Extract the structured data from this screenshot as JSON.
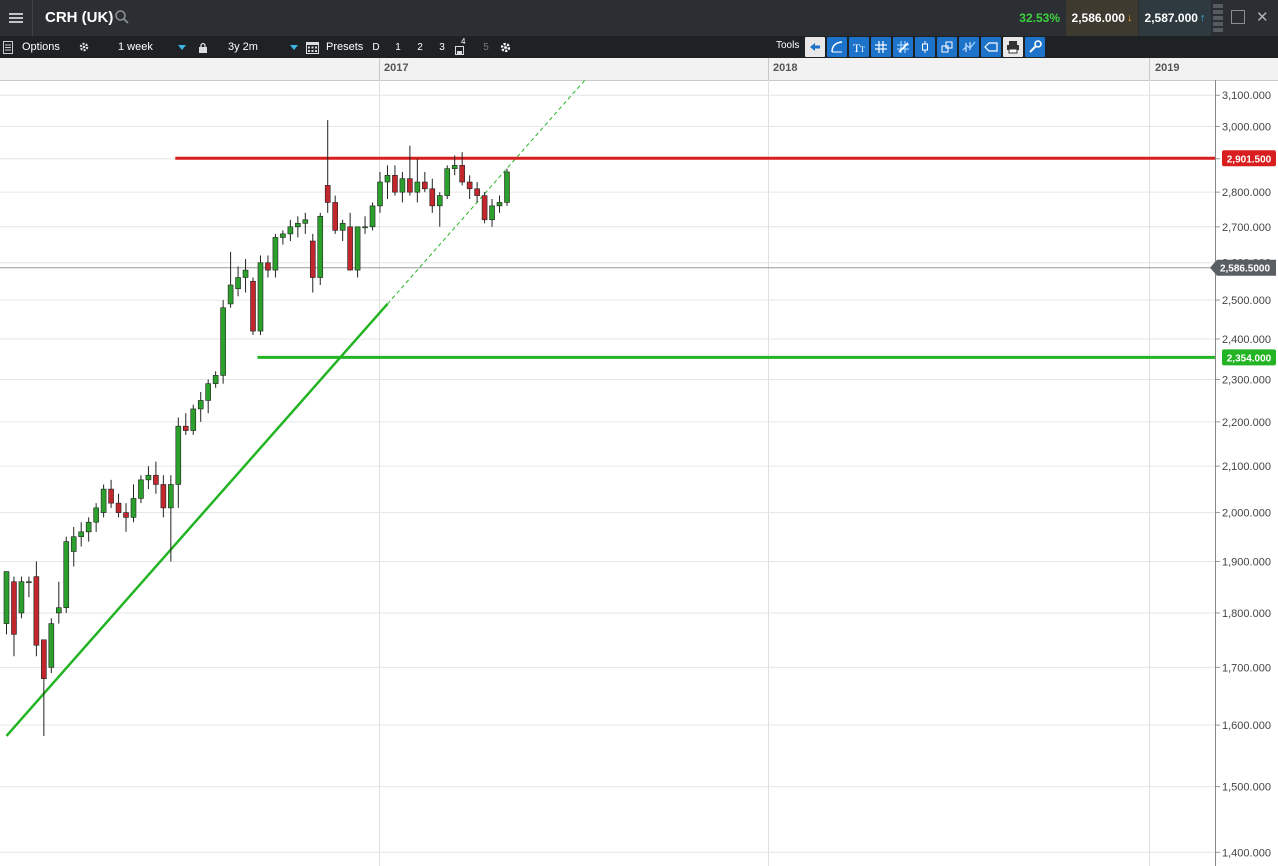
{
  "header": {
    "title": "CRH (UK)",
    "change_pct": "32.53%",
    "sell_price": "2,586.000",
    "buy_price": "2,587.000"
  },
  "toolbar": {
    "options_label": "Options",
    "interval": "1 week",
    "range": "3y 2m",
    "presets_label": "Presets",
    "preset_buttons": [
      "D",
      "1",
      "2",
      "3",
      "4",
      "5"
    ],
    "tools_label": "Tools"
  },
  "colors": {
    "up_candle": "#2ca02c",
    "down_candle": "#c1272d",
    "resistance": "#d81e1e",
    "support": "#22b422",
    "trendline": "#22b422",
    "tool_blue": "#1d73c9"
  },
  "chart_data": {
    "type": "candlestick",
    "x_axis_labels": [
      "2017",
      "2018",
      "2019"
    ],
    "y_ticks": [
      "3,100.000",
      "3,000.000",
      "2,900.000",
      "2,800.000",
      "2,700.000",
      "2,600.000",
      "2,500.000",
      "2,400.000",
      "2,300.000",
      "2,200.000",
      "2,100.000",
      "2,000.000",
      "1,900.000",
      "1,800.000",
      "1,700.000",
      "1,600.000",
      "1,500.000",
      "1,400.000"
    ],
    "y_tick_values": [
      3100,
      3000,
      2900,
      2800,
      2700,
      2600,
      2500,
      2400,
      2300,
      2200,
      2100,
      2000,
      1900,
      1800,
      1700,
      1600,
      1500,
      1400
    ],
    "ylim": [
      1380,
      3150
    ],
    "scale": "log",
    "first_week": "2016-08-01",
    "current_price_label": "2,586.5000",
    "current_price": 2586.5,
    "resistance": {
      "value": 2901.5,
      "label": "2,901.500",
      "start_week": 23
    },
    "support": {
      "value": 2354,
      "label": "2,354.000",
      "start_week": 34
    },
    "trendline": {
      "start": [
        0,
        1582
      ],
      "end": [
        51,
        2490
      ],
      "extend_to_week": 83
    },
    "candles": [
      {
        "o": 1780,
        "h": 1880,
        "l": 1760,
        "c": 1880
      },
      {
        "o": 1860,
        "h": 1870,
        "l": 1720,
        "c": 1760
      },
      {
        "o": 1800,
        "h": 1870,
        "l": 1790,
        "c": 1860
      },
      {
        "o": 1860,
        "h": 1870,
        "l": 1830,
        "c": 1860
      },
      {
        "o": 1870,
        "h": 1900,
        "l": 1720,
        "c": 1740
      },
      {
        "o": 1750,
        "h": 1750,
        "l": 1582,
        "c": 1680
      },
      {
        "o": 1700,
        "h": 1790,
        "l": 1690,
        "c": 1780
      },
      {
        "o": 1800,
        "h": 1860,
        "l": 1780,
        "c": 1810
      },
      {
        "o": 1810,
        "h": 1950,
        "l": 1800,
        "c": 1940
      },
      {
        "o": 1920,
        "h": 1970,
        "l": 1890,
        "c": 1950
      },
      {
        "o": 1950,
        "h": 1980,
        "l": 1930,
        "c": 1960
      },
      {
        "o": 1960,
        "h": 1990,
        "l": 1940,
        "c": 1980
      },
      {
        "o": 1980,
        "h": 2020,
        "l": 1960,
        "c": 2010
      },
      {
        "o": 2000,
        "h": 2060,
        "l": 1990,
        "c": 2050
      },
      {
        "o": 2050,
        "h": 2070,
        "l": 2010,
        "c": 2020
      },
      {
        "o": 2020,
        "h": 2040,
        "l": 1990,
        "c": 2000
      },
      {
        "o": 2000,
        "h": 2020,
        "l": 1960,
        "c": 1990
      },
      {
        "o": 1990,
        "h": 2060,
        "l": 1980,
        "c": 2030
      },
      {
        "o": 2030,
        "h": 2080,
        "l": 2020,
        "c": 2070
      },
      {
        "o": 2070,
        "h": 2100,
        "l": 2050,
        "c": 2080
      },
      {
        "o": 2080,
        "h": 2110,
        "l": 2040,
        "c": 2060
      },
      {
        "o": 2060,
        "h": 2080,
        "l": 1990,
        "c": 2010
      },
      {
        "o": 2010,
        "h": 2080,
        "l": 1900,
        "c": 2060
      },
      {
        "o": 2060,
        "h": 2210,
        "l": 2010,
        "c": 2190
      },
      {
        "o": 2190,
        "h": 2220,
        "l": 2170,
        "c": 2180
      },
      {
        "o": 2180,
        "h": 2240,
        "l": 2170,
        "c": 2230
      },
      {
        "o": 2230,
        "h": 2270,
        "l": 2200,
        "c": 2250
      },
      {
        "o": 2250,
        "h": 2300,
        "l": 2220,
        "c": 2290
      },
      {
        "o": 2290,
        "h": 2320,
        "l": 2280,
        "c": 2310
      },
      {
        "o": 2310,
        "h": 2500,
        "l": 2290,
        "c": 2480
      },
      {
        "o": 2490,
        "h": 2630,
        "l": 2480,
        "c": 2540
      },
      {
        "o": 2530,
        "h": 2590,
        "l": 2510,
        "c": 2560
      },
      {
        "o": 2560,
        "h": 2610,
        "l": 2520,
        "c": 2580
      },
      {
        "o": 2550,
        "h": 2560,
        "l": 2410,
        "c": 2420
      },
      {
        "o": 2420,
        "h": 2620,
        "l": 2410,
        "c": 2600
      },
      {
        "o": 2600,
        "h": 2620,
        "l": 2560,
        "c": 2580
      },
      {
        "o": 2580,
        "h": 2680,
        "l": 2560,
        "c": 2670
      },
      {
        "o": 2670,
        "h": 2690,
        "l": 2650,
        "c": 2680
      },
      {
        "o": 2680,
        "h": 2720,
        "l": 2660,
        "c": 2700
      },
      {
        "o": 2700,
        "h": 2730,
        "l": 2670,
        "c": 2710
      },
      {
        "o": 2710,
        "h": 2740,
        "l": 2680,
        "c": 2720
      },
      {
        "o": 2660,
        "h": 2680,
        "l": 2520,
        "c": 2560
      },
      {
        "o": 2560,
        "h": 2740,
        "l": 2540,
        "c": 2730
      },
      {
        "o": 2820,
        "h": 3020,
        "l": 2740,
        "c": 2770
      },
      {
        "o": 2770,
        "h": 2790,
        "l": 2680,
        "c": 2690
      },
      {
        "o": 2690,
        "h": 2720,
        "l": 2660,
        "c": 2710
      },
      {
        "o": 2700,
        "h": 2740,
        "l": 2580,
        "c": 2580
      },
      {
        "o": 2580,
        "h": 2700,
        "l": 2560,
        "c": 2700
      },
      {
        "o": 2700,
        "h": 2730,
        "l": 2680,
        "c": 2700
      },
      {
        "o": 2700,
        "h": 2770,
        "l": 2690,
        "c": 2760
      },
      {
        "o": 2760,
        "h": 2860,
        "l": 2740,
        "c": 2830
      },
      {
        "o": 2830,
        "h": 2880,
        "l": 2780,
        "c": 2850
      },
      {
        "o": 2850,
        "h": 2880,
        "l": 2790,
        "c": 2800
      },
      {
        "o": 2800,
        "h": 2860,
        "l": 2770,
        "c": 2840
      },
      {
        "o": 2840,
        "h": 2940,
        "l": 2790,
        "c": 2800
      },
      {
        "o": 2800,
        "h": 2900,
        "l": 2770,
        "c": 2830
      },
      {
        "o": 2830,
        "h": 2860,
        "l": 2800,
        "c": 2810
      },
      {
        "o": 2810,
        "h": 2840,
        "l": 2740,
        "c": 2760
      },
      {
        "o": 2760,
        "h": 2800,
        "l": 2700,
        "c": 2790
      },
      {
        "o": 2790,
        "h": 2880,
        "l": 2780,
        "c": 2870
      },
      {
        "o": 2870,
        "h": 2910,
        "l": 2850,
        "c": 2880
      },
      {
        "o": 2880,
        "h": 2920,
        "l": 2820,
        "c": 2830
      },
      {
        "o": 2830,
        "h": 2850,
        "l": 2780,
        "c": 2810
      },
      {
        "o": 2810,
        "h": 2830,
        "l": 2770,
        "c": 2790
      },
      {
        "o": 2790,
        "h": 2800,
        "l": 2710,
        "c": 2720
      },
      {
        "o": 2720,
        "h": 2780,
        "l": 2700,
        "c": 2760
      },
      {
        "o": 2760,
        "h": 2790,
        "l": 2740,
        "c": 2770
      },
      {
        "o": 2770,
        "h": 2870,
        "l": 2760,
        "c": 2860
      }
    ]
  }
}
